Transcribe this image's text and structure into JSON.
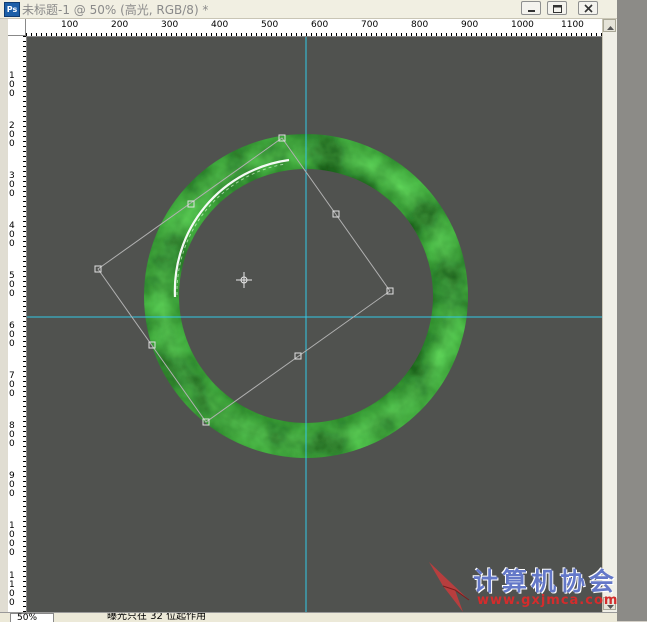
{
  "app": {
    "icon_label": "Ps"
  },
  "window": {
    "title": "未标题-1 @ 50% (高光, RGB/8) *"
  },
  "ruler_h": [
    "100",
    "200",
    "300",
    "400",
    "500",
    "600",
    "700",
    "800",
    "900",
    "1000",
    "1100"
  ],
  "ruler_v": [
    "1\n0\n0",
    "2\n0\n0",
    "3\n0\n0",
    "4\n0\n0",
    "5\n0\n0",
    "6\n0\n0",
    "7\n0\n0",
    "8\n0\n0",
    "9\n0\n0",
    "1\n0\n0\n0",
    "1\n1\n0\n0"
  ],
  "status": {
    "zoom": "50%",
    "message": "曝光只在 32 位起作用"
  },
  "watermark": {
    "name": "计算机协会",
    "url": "www.gxjmca.com"
  },
  "colors": {
    "canvas_bg": "#50524f",
    "guide": "#32c8e6",
    "jade": "#3fae3a"
  }
}
